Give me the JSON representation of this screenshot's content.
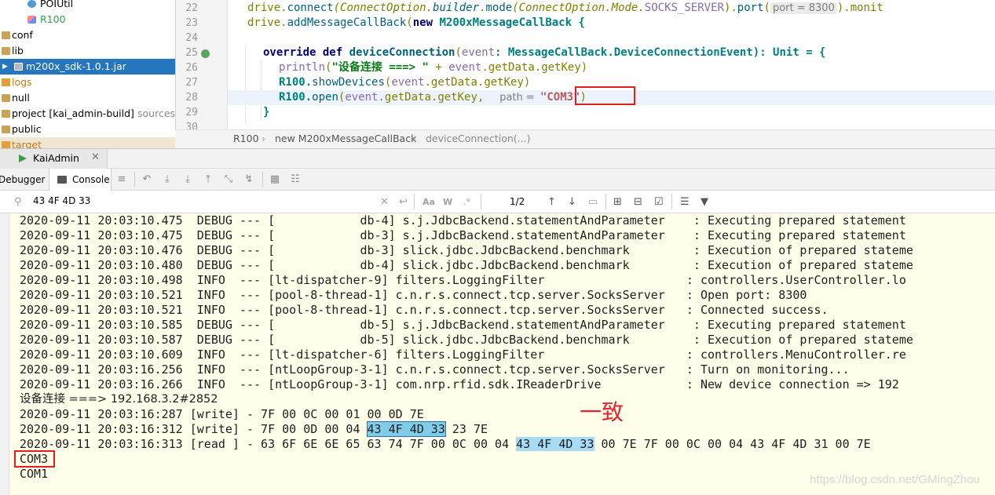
{
  "project_tree": {
    "items": [
      {
        "label": "POIUtil"
      },
      {
        "label": "R100"
      },
      {
        "label": "conf"
      },
      {
        "label": "lib"
      },
      {
        "label": "m200x_sdk-1.0.1.jar"
      },
      {
        "label": "logs"
      },
      {
        "label": "null"
      },
      {
        "label": "project [kai_admin-build]",
        "suffix": "sources"
      },
      {
        "label": "public"
      },
      {
        "label": "target"
      }
    ]
  },
  "editor": {
    "line_numbers": [
      "22",
      "23",
      "24",
      "25",
      "26",
      "27",
      "28",
      "29"
    ],
    "code": {
      "l22_a": "drive.",
      "l22_b": "connect",
      "l22_c": "(ConnectOption.",
      "l22_d": "builder",
      "l22_e": ".",
      "l22_f": "mode",
      "l22_g": "(ConnectOption.Mode.",
      "l22_h": "SOCKS_SERVER",
      "l22_i": ").",
      "l22_j": "port",
      "l22_k": "(",
      "l22_hint": "port = 8300",
      "l22_l": ").monit",
      "l23_a": "drive.",
      "l23_b": "addMessageCallBack",
      "l23_c": "(",
      "l23_d": "new",
      "l23_e": " M200xMessageCallBack {",
      "l25_a": "override def",
      "l25_b": " deviceConnection",
      "l25_c": "(",
      "l25_d": "event",
      "l25_e": ": MessageCallBack.DeviceConnectionEvent): Unit = {",
      "l26_a": "println",
      "l26_b": "(",
      "l26_c": "\"设备连接 ===> \"",
      "l26_d": " + ",
      "l26_e": "event",
      "l26_f": ".getData.getKey)",
      "l27_a": "R100.",
      "l27_b": "showDevices",
      "l27_c": "(",
      "l27_d": "event",
      "l27_e": ".getData.getKey)",
      "l28_a": "R100.",
      "l28_b": "open",
      "l28_c": "(",
      "l28_d": "event",
      "l28_e": ".getData.getKey,  ",
      "l28_hint": "path = ",
      "l28_f": "\"COM3\"",
      "l28_g": ")",
      "l29_a": "}"
    }
  },
  "breadcrumb": {
    "items": [
      "R100",
      "new M200xMessageCallBack",
      "deviceConnection(...)"
    ],
    "separator": "›"
  },
  "run_window": {
    "tab_label": "KaiAdmin",
    "debugger_tab": "Debugger",
    "console_tab": "Console"
  },
  "search": {
    "query": "43 4F 4D 33",
    "match_count": "1/2",
    "case_label": "Aa",
    "words_label": "W",
    "regex_label": ".*"
  },
  "console": {
    "lines": [
      "2020-09-11 20:03:10.475  DEBUG --- [            db-4] s.j.JdbcBackend.statementAndParameter    : Executing prepared statement",
      "2020-09-11 20:03:10.475  DEBUG --- [            db-3] s.j.JdbcBackend.statementAndParameter    : Executing prepared statement",
      "2020-09-11 20:03:10.476  DEBUG --- [            db-3] slick.jdbc.JdbcBackend.benchmark         : Execution of prepared stateme",
      "2020-09-11 20:03:10.480  DEBUG --- [            db-4] slick.jdbc.JdbcBackend.benchmark         : Execution of prepared stateme",
      "2020-09-11 20:03:10.498  INFO  --- [lt-dispatcher-9] filters.LoggingFilter                    : controllers.UserController.lo",
      "2020-09-11 20:03:10.521  INFO  --- [pool-8-thread-1] c.n.r.s.connect.tcp.server.SocksServer   : Open port: 8300",
      "2020-09-11 20:03:10.521  INFO  --- [pool-8-thread-1] c.n.r.s.connect.tcp.server.SocksServer   : Connected success.",
      "2020-09-11 20:03:10.585  DEBUG --- [            db-5] s.j.JdbcBackend.statementAndParameter    : Executing prepared statement",
      "2020-09-11 20:03:10.587  DEBUG --- [            db-5] slick.jdbc.JdbcBackend.benchmark         : Execution of prepared stateme",
      "2020-09-11 20:03:10.609  INFO  --- [lt-dispatcher-6] filters.LoggingFilter                    : controllers.MenuController.re",
      "2020-09-11 20:03:16.256  INFO  --- [ntLoopGroup-3-1] c.n.r.s.connect.tcp.server.SocksServer   : Turn on monitoring...",
      "2020-09-11 20:03:16.266  INFO  --- [ntLoopGroup-3-1] com.nrp.rfid.sdk.IReaderDrive            : New device connection => 192"
    ],
    "device_line": "设备连接 ===> 192.168.3.2#2852",
    "write1": "2020-09-11 20:03:16:287 [write] - 7F 00 0C 00 01 00 0D 7E",
    "write2_a": "2020-09-11 20:03:16:312 [write] - 7F 00 0D 00 04 ",
    "write2_match": "43 4F 4D 33",
    "write2_b": " 23 7E",
    "read_a": "2020-09-11 20:03:16:313 [read ] - 63 6F 6E 6E 65 63 74 7F 00 0C 00 04 ",
    "read_match": "43 4F 4D 33",
    "read_b": " 00 7E 7F 00 0C 00 04 43 4F 4D 31 00 7E",
    "com3": "COM3",
    "com1": "COM1"
  },
  "annotation": "一致",
  "watermark": "https://blog.csdn.net/GMingZhou",
  "colors": {
    "selection": "#2675bf",
    "annotation_red": "#e02020",
    "console_bg": "#fffeea",
    "match": "#a8dcf5"
  }
}
